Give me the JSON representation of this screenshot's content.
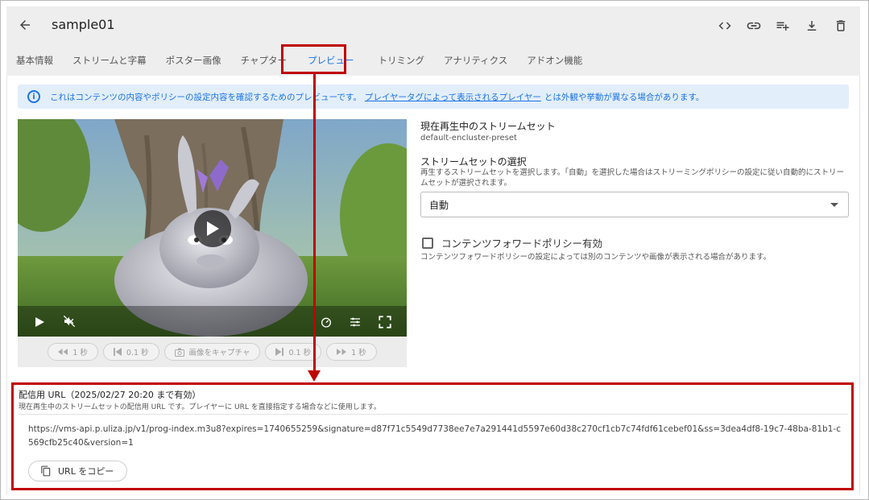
{
  "header": {
    "title": "sample01",
    "icons": [
      "code-icon",
      "link-icon",
      "playlist-add-icon",
      "download-icon",
      "delete-icon"
    ]
  },
  "tabs": [
    {
      "label": "基本情報"
    },
    {
      "label": "ストリームと字幕"
    },
    {
      "label": "ポスター画像"
    },
    {
      "label": "チャプター"
    },
    {
      "label": "プレビュー",
      "active": true
    },
    {
      "label": "トリミング"
    },
    {
      "label": "アナリティクス"
    },
    {
      "label": "アドオン機能"
    }
  ],
  "info": {
    "text_before": "これはコンテンツの内容やポリシーの設定内容を確認するためのプレビューです。",
    "link": "プレイヤータグによって表示されるプレイヤー",
    "text_after": "とは外観や挙動が異なる場合があります。"
  },
  "player_controls": [
    {
      "label": "1 秒"
    },
    {
      "label": "0.1 秒"
    },
    {
      "label": "画像をキャプチャ"
    },
    {
      "label": "0.1 秒"
    },
    {
      "label": "1 秒"
    }
  ],
  "stream": {
    "current_label": "現在再生中のストリームセット",
    "current_value": "default-encluster-preset",
    "select_label": "ストリームセットの選択",
    "select_help": "再生するストリームセットを選択します。「自動」を選択した場合はストリーミングポリシーの設定に従い自動的にストリームセットが選択されます。",
    "select_value": "自動"
  },
  "policy": {
    "checkbox_label": "コンテンツフォワードポリシー有効",
    "help": "コンテンツフォワードポリシーの設定によっては別のコンテンツや画像が表示される場合があります。"
  },
  "delivery": {
    "title": "配信用 URL（2025/02/27 20:20 まで有効）",
    "subtitle": "現在再生中のストリームセットの配信用 URL です。プレイヤーに URL を直接指定する場合などに使用します。",
    "url": "https://vms-api.p.uliza.jp/v1/prog-index.m3u8?expires=1740655259&signature=d87f71c5549d7738ee7e7a291441d5597e60d38c270cf1cb7c74fdf61cebef01&ss=3dea4df8-19c7-48ba-81b1-c569cfb25c40&version=1",
    "copy_label": "URL をコピー"
  },
  "colors": {
    "accent": "#1a73e8",
    "highlight": "#c00000"
  }
}
